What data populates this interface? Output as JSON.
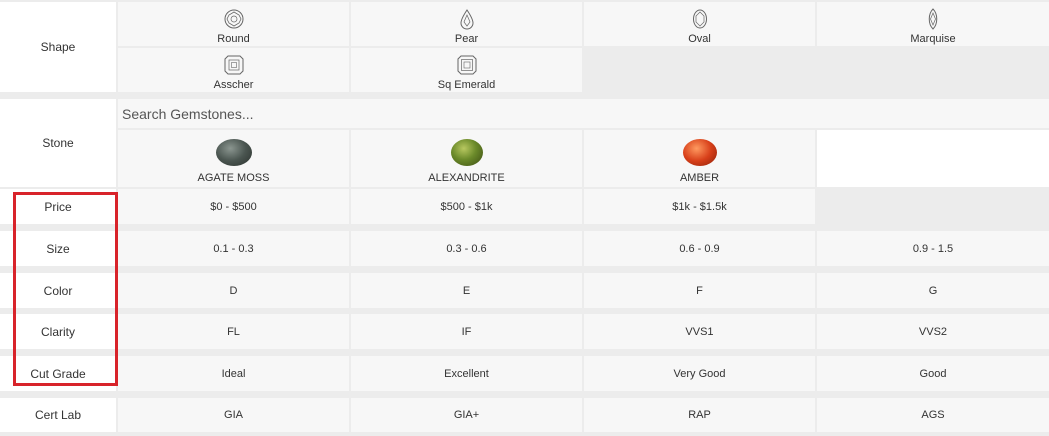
{
  "shape": {
    "label": "Shape",
    "options": [
      {
        "label": "Round",
        "icon": "round-diamond-icon"
      },
      {
        "label": "Pear",
        "icon": "pear-diamond-icon"
      },
      {
        "label": "Oval",
        "icon": "oval-diamond-icon"
      },
      {
        "label": "Marquise",
        "icon": "marquise-diamond-icon"
      },
      {
        "label": "Asscher",
        "icon": "asscher-diamond-icon"
      },
      {
        "label": "Sq Emerald",
        "icon": "sq-emerald-diamond-icon"
      }
    ]
  },
  "stone": {
    "label": "Stone",
    "search_placeholder": "Search Gemstones...",
    "options": [
      {
        "label": "AGATE MOSS",
        "color": "#4a5550"
      },
      {
        "label": "ALEXANDRITE",
        "color": "#6b8a2a"
      },
      {
        "label": "AMBER",
        "color": "#d8401a"
      }
    ]
  },
  "filters": [
    {
      "label": "Price",
      "values": [
        "$0 - $500",
        "$500 - $1k",
        "$1k - $1.5k"
      ]
    },
    {
      "label": "Size",
      "values": [
        "0.1 - 0.3",
        "0.3 - 0.6",
        "0.6 - 0.9",
        "0.9 - 1.5"
      ]
    },
    {
      "label": "Color",
      "values": [
        "D",
        "E",
        "F",
        "G"
      ]
    },
    {
      "label": "Clarity",
      "values": [
        "FL",
        "IF",
        "VVS1",
        "VVS2"
      ]
    },
    {
      "label": "Cut Grade",
      "values": [
        "Ideal",
        "Excellent",
        "Very Good",
        "Good"
      ]
    },
    {
      "label": "Cert Lab",
      "values": [
        "GIA",
        "GIA+",
        "RAP",
        "AGS"
      ]
    }
  ],
  "colors": {
    "highlight": "#d8232a"
  }
}
